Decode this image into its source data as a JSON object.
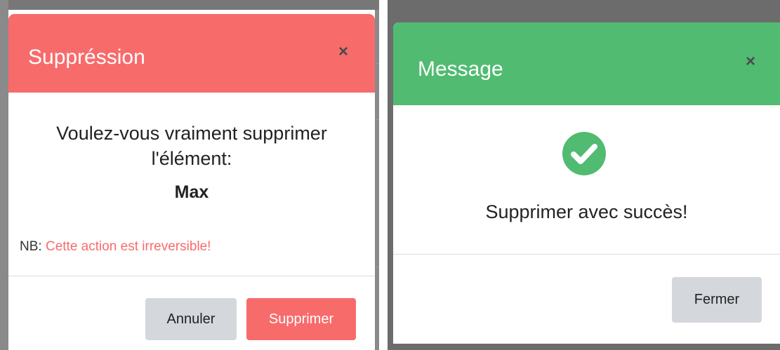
{
  "delete_modal": {
    "title": "Suppréssion",
    "close_symbol": "×",
    "confirm_text": "Voulez-vous vraiment supprimer l'élément:",
    "item_name": "Max",
    "note_prefix": "NB:",
    "note_warning": "Cette action est irreversible!",
    "cancel_label": "Annuler",
    "delete_label": "Supprimer",
    "header_color": "#f86b6b"
  },
  "message_modal": {
    "title": "Message",
    "close_symbol": "×",
    "success_icon": "check-circle-icon",
    "success_text": "Supprimer avec succès!",
    "close_label": "Fermer",
    "header_color": "#51bb71"
  }
}
